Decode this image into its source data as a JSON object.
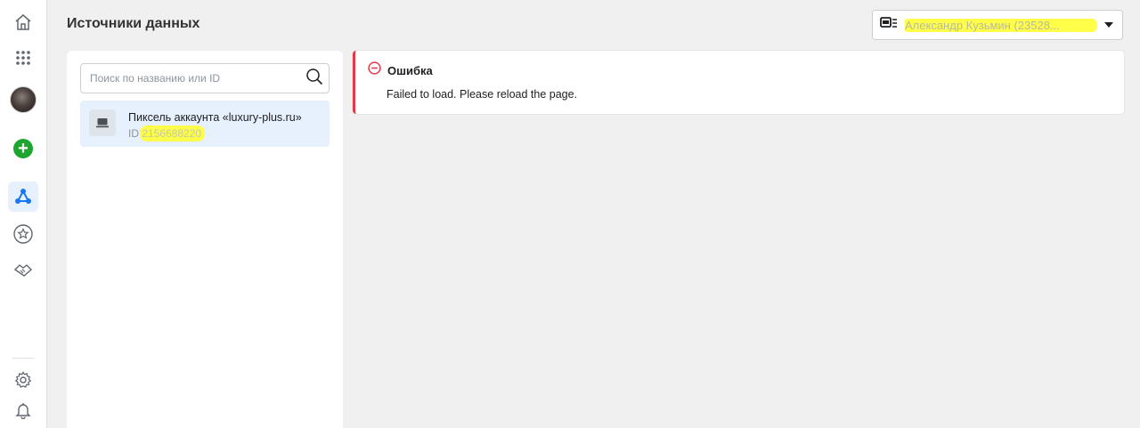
{
  "header": {
    "title": "Источники данных",
    "account_selector": {
      "icon": "business-account-icon",
      "label": "Александр Кузьмин (23528...",
      "caret": "chevron-down-icon"
    }
  },
  "rail": {
    "items": [
      {
        "name": "home-icon"
      },
      {
        "name": "apps-grid-icon"
      },
      {
        "name": "avatar"
      },
      {
        "name": "create-plus-icon"
      },
      {
        "name": "events-manager-icon",
        "active": true
      },
      {
        "name": "favorites-star-icon"
      },
      {
        "name": "partners-handshake-icon"
      },
      {
        "name": "settings-gear-icon"
      },
      {
        "name": "notifications-bell-icon"
      }
    ]
  },
  "search": {
    "placeholder": "Поиск по названию или ID",
    "value": ""
  },
  "sources": [
    {
      "name": "Пиксель аккаунта «luxury-plus.ru»",
      "id_prefix": "ID",
      "id_value": "2156688220"
    }
  ],
  "error": {
    "title": "Ошибка",
    "message": "Failed to load. Please reload the page."
  },
  "colors": {
    "accent": "#1877f2",
    "error": "#e0394a",
    "selected_bg": "#e7f0fd",
    "highlight": "#ffff3b"
  }
}
